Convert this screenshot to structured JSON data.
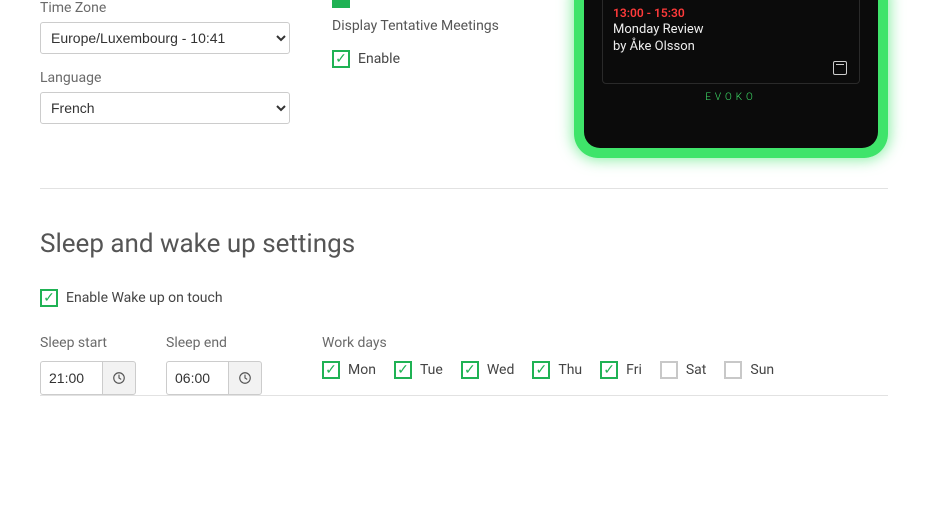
{
  "timezone": {
    "label": "Time Zone",
    "value": "Europe/Luxembourg - 10:41"
  },
  "language": {
    "label": "Language",
    "value": "French"
  },
  "tentative": {
    "heading": "Display Tentative Meetings",
    "enable": "Enable"
  },
  "device": {
    "time": "13:00 - 15:30",
    "title": "Monday Review",
    "by": "by Åke Olsson",
    "brand": "EVOKO"
  },
  "section_heading": "Sleep and wake up settings",
  "wake_on_touch": "Enable Wake up on touch",
  "sleep_start": {
    "label": "Sleep start",
    "value": "21:00"
  },
  "sleep_end": {
    "label": "Sleep end",
    "value": "06:00"
  },
  "workdays": {
    "label": "Work days",
    "mon": "Mon",
    "tue": "Tue",
    "wed": "Wed",
    "thu": "Thu",
    "fri": "Fri",
    "sat": "Sat",
    "sun": "Sun"
  },
  "checked": {
    "mon": true,
    "tue": true,
    "wed": true,
    "thu": true,
    "fri": true,
    "sat": false,
    "sun": false
  }
}
